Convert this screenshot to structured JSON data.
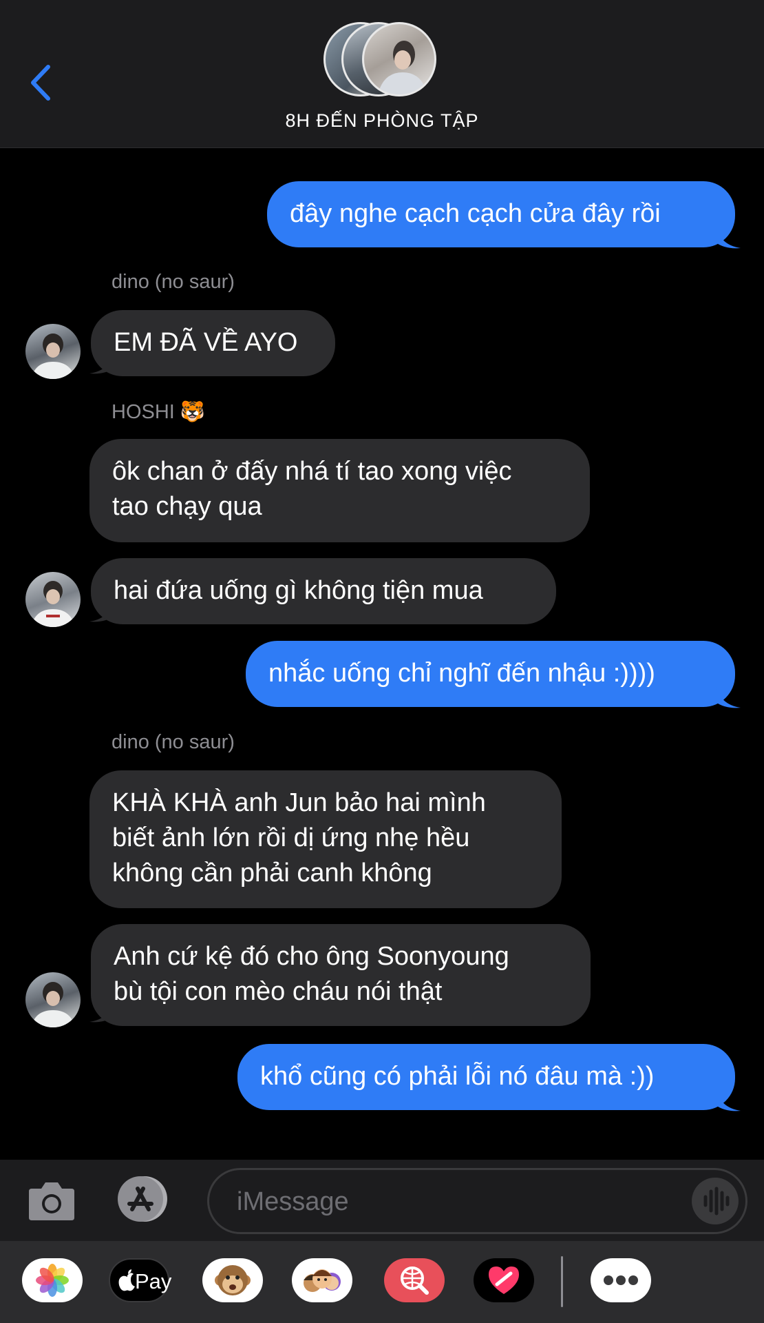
{
  "header": {
    "title": "8H ĐẾN PHÒNG TẬP"
  },
  "messages": [
    {
      "side": "out",
      "text": "đây nghe cạch cạch cửa đây rồi"
    },
    {
      "side": "in",
      "sender": "dino (no saur)",
      "text": "EM ĐÃ VỀ AYO"
    },
    {
      "side": "in",
      "sender": "HOSHI 🐯",
      "text": "ôk chan ở đấy nhá tí tao xong việc tao chạy qua"
    },
    {
      "side": "in",
      "text": "hai đứa uống gì không tiện mua"
    },
    {
      "side": "out",
      "text": "nhắc uống chỉ nghĩ đến nhậu :))))"
    },
    {
      "side": "in",
      "sender": "dino (no saur)",
      "text": "KHÀ KHÀ anh Jun bảo hai mình biết ảnh lớn rồi dị ứng nhẹ hều không cần phải canh không"
    },
    {
      "side": "in",
      "text": "Anh cứ kệ đó cho ông Soonyoung bù tội con mèo cháu nói thật"
    },
    {
      "side": "out",
      "text": "khổ cũng có phải lỗi nó đâu mà :))"
    }
  ],
  "senders": {
    "dino_1": "dino (no saur)",
    "hoshi": "HOSHI",
    "hoshi_emoji": "🐯",
    "dino_2": "dino (no saur)"
  },
  "bubbles": {
    "m1": "đây nghe cạch cạch cửa đây rồi",
    "m2": "EM ĐÃ VỀ AYO",
    "m3_l1": "ôk chan ở đấy nhá tí tao xong việc",
    "m3_l2": "tao chạy qua",
    "m4": "hai đứa uống gì không tiện mua",
    "m5": "nhắc uống chỉ nghĩ đến nhậu :))))",
    "m6_l1": "KHÀ KHÀ anh Jun bảo hai mình",
    "m6_l2": "biết ảnh lớn rồi dị ứng nhẹ hều",
    "m6_l3": "không cần phải canh không",
    "m7_l1": "Anh cứ kệ đó cho ông Soonyoung",
    "m7_l2": "bù tội con mèo cháu nói thật",
    "m8": "khổ cũng có phải lỗi nó đâu mà :))"
  },
  "input": {
    "placeholder": "iMessage"
  },
  "apps": {
    "applepay_label": "Pay"
  },
  "icons": [
    "back-chevron-icon",
    "camera-icon",
    "app-store-icon",
    "voice-waveform-icon",
    "photos-icon",
    "apple-pay-icon",
    "animoji-monkey-icon",
    "memoji-icon",
    "search-globe-icon",
    "digital-touch-heart-icon",
    "more-icon"
  ],
  "colors": {
    "accent": "#2f7cf6",
    "incoming_bubble": "#2c2c2e",
    "header_bg": "#1c1c1e",
    "sender_name": "#8e8e93"
  }
}
